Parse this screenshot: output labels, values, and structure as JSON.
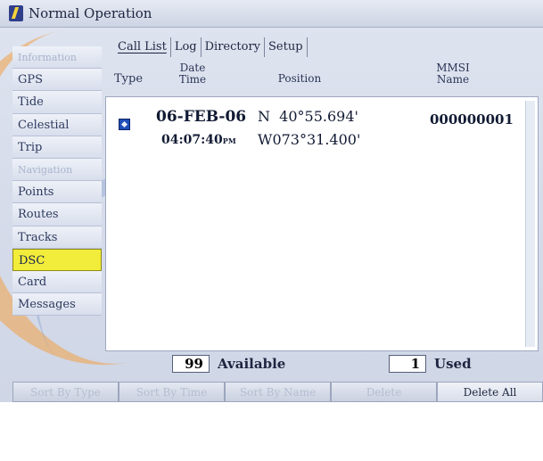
{
  "window": {
    "title": "Normal Operation"
  },
  "sidebar": {
    "items": [
      {
        "label": "Information",
        "state": "dim"
      },
      {
        "label": "GPS",
        "state": "normal"
      },
      {
        "label": "Tide",
        "state": "normal"
      },
      {
        "label": "Celestial",
        "state": "normal"
      },
      {
        "label": "Trip",
        "state": "normal"
      },
      {
        "label": "Navigation",
        "state": "dim"
      },
      {
        "label": "Points",
        "state": "normal"
      },
      {
        "label": "Routes",
        "state": "normal"
      },
      {
        "label": "Tracks",
        "state": "normal"
      },
      {
        "label": "DSC",
        "state": "active"
      },
      {
        "label": "Card",
        "state": "normal"
      },
      {
        "label": "Messages",
        "state": "normal"
      }
    ]
  },
  "tabs": [
    {
      "label": "Call List",
      "active": true
    },
    {
      "label": "Log",
      "active": false
    },
    {
      "label": "Directory",
      "active": false
    },
    {
      "label": "Setup",
      "active": false
    }
  ],
  "columns": {
    "type": "Type",
    "date_time_line1": "Date",
    "date_time_line2": "Time",
    "position": "Position",
    "mmsi_line1": "MMSI",
    "mmsi_line2": "Name"
  },
  "calls": [
    {
      "type_icon": "dsc-position-icon",
      "date": "06-FEB-06",
      "time": "04:07:40",
      "time_suffix": "PM",
      "lat": "N  40°55.694'",
      "lon": "W073°31.400'",
      "mmsi": "000000001"
    }
  ],
  "footer": {
    "available_count": "99",
    "available_label": "Available",
    "used_count": "1",
    "used_label": "Used"
  },
  "softkeys": [
    {
      "label": "Sort By Type",
      "enabled": false
    },
    {
      "label": "Sort By Time",
      "enabled": false
    },
    {
      "label": "Sort By Name",
      "enabled": false
    },
    {
      "label": "Delete",
      "enabled": false
    },
    {
      "label": "Delete All",
      "enabled": true
    }
  ],
  "colors": {
    "active_tab_highlight": "#f2ec3a",
    "dsc_icon": "#1f4fb8"
  }
}
